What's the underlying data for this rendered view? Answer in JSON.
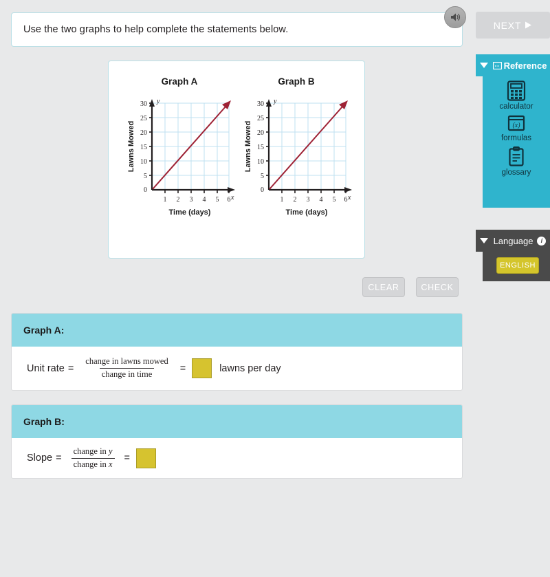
{
  "prompt": {
    "text": "Use the two graphs to help complete the statements below.",
    "audio_icon": "speaker-icon"
  },
  "actions": {
    "clear_label": "CLEAR",
    "check_label": "CHECK"
  },
  "sidebar": {
    "next_label": "NEXT",
    "reference": {
      "title": "Reference",
      "items": [
        {
          "label": "calculator",
          "icon": "calculator-icon"
        },
        {
          "label": "formulas",
          "icon": "formulas-icon"
        },
        {
          "label": "glossary",
          "icon": "glossary-icon"
        }
      ]
    },
    "language": {
      "title": "Language",
      "info": "i",
      "selected": "ENGLISH"
    }
  },
  "answers": [
    {
      "header": "Graph A:",
      "label": "Unit rate",
      "numerator": "change in lawns mowed",
      "denominator": "change in time",
      "value": "",
      "unit": "lawns per day"
    },
    {
      "header": "Graph B:",
      "label": "Slope",
      "numerator_pre": "change in ",
      "numerator_var": "y",
      "denominator_pre": "change in ",
      "denominator_var": "x",
      "value": "",
      "unit": ""
    }
  ],
  "chart_data": [
    {
      "type": "line",
      "title": "Graph A",
      "xlabel": "Time (days)",
      "ylabel": "Lawns Mowed",
      "x_axis_name": "x",
      "y_axis_name": "y",
      "xticks": [
        0,
        1,
        2,
        3,
        4,
        5,
        6
      ],
      "yticks": [
        0,
        5,
        10,
        15,
        20,
        25,
        30
      ],
      "xlim": [
        0,
        6
      ],
      "ylim": [
        0,
        30
      ],
      "grid": true,
      "series": [
        {
          "name": "lawns mowed",
          "color": "#9e2235",
          "x": [
            0,
            6
          ],
          "values": [
            0,
            30
          ],
          "slope": 5,
          "arrow": true
        }
      ]
    },
    {
      "type": "line",
      "title": "Graph B",
      "xlabel": "Time (days)",
      "ylabel": "Lawns Mowed",
      "x_axis_name": "x",
      "y_axis_name": "y",
      "xticks": [
        0,
        1,
        2,
        3,
        4,
        5,
        6
      ],
      "yticks": [
        0,
        5,
        10,
        15,
        20,
        25,
        30
      ],
      "xlim": [
        0,
        6
      ],
      "ylim": [
        0,
        30
      ],
      "grid": true,
      "series": [
        {
          "name": "lawns mowed",
          "color": "#9e2235",
          "x": [
            0,
            6
          ],
          "values": [
            0,
            30
          ],
          "slope": 5,
          "arrow": true
        }
      ]
    }
  ],
  "colors": {
    "background": "#e8e9ea",
    "card_border": "#b9dfe6",
    "answer_header": "#8ed8e4",
    "answer_box": "#d6c32f",
    "reference_panel": "#2fb4cd",
    "language_panel": "#4a4a4a",
    "english_button": "#d4c52b",
    "line": "#9e2235",
    "grid": "#bfe0f0",
    "disabled_button": "#d5d6d8"
  }
}
